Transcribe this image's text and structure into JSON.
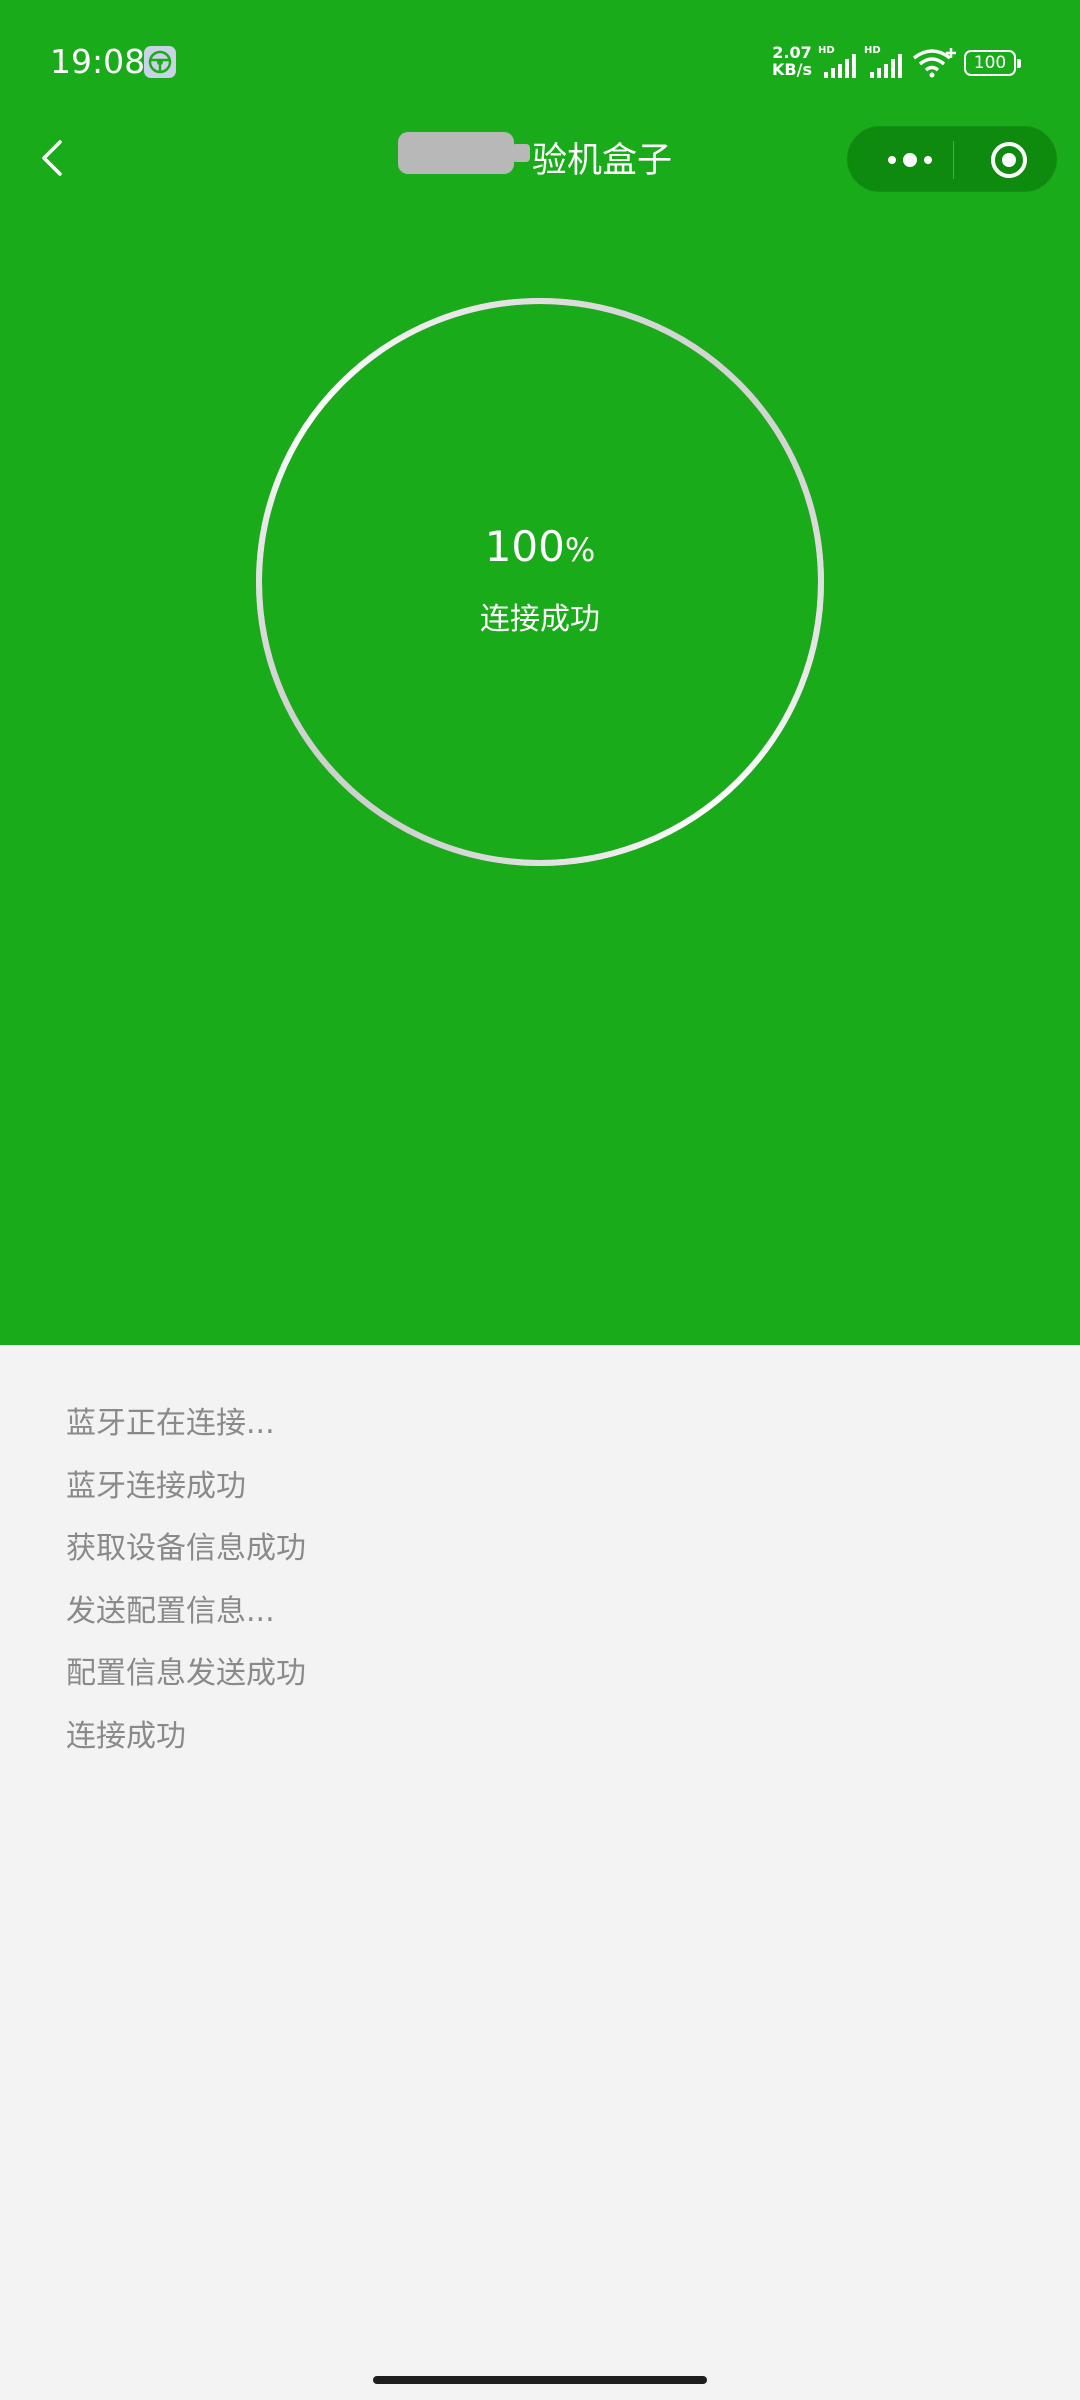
{
  "status_bar": {
    "time": "19:08",
    "net_speed_value": "2.07",
    "net_speed_unit": "KB/s",
    "sim1_label": "HD",
    "sim2_label": "HD",
    "battery": "100"
  },
  "nav": {
    "title_suffix": "验机盒子"
  },
  "progress": {
    "value": "100",
    "unit": "%",
    "fraction": 1.0,
    "status": "连接成功"
  },
  "log": [
    "蓝牙正在连接...",
    "蓝牙连接成功",
    "获取设备信息成功",
    "发送配置信息...",
    "配置信息发送成功",
    "连接成功"
  ],
  "colors": {
    "primary_green": "#1aab1a",
    "capsule_green": "#0e8a0e",
    "page_background": "#f3f3f3",
    "log_text": "#8a8a8a"
  },
  "icons": {
    "back": "chevron-left-icon",
    "more": "more-dots-icon",
    "close": "target-close-icon",
    "wifi": "wifi-icon",
    "signal": "signal-icon",
    "battery": "battery-icon"
  }
}
